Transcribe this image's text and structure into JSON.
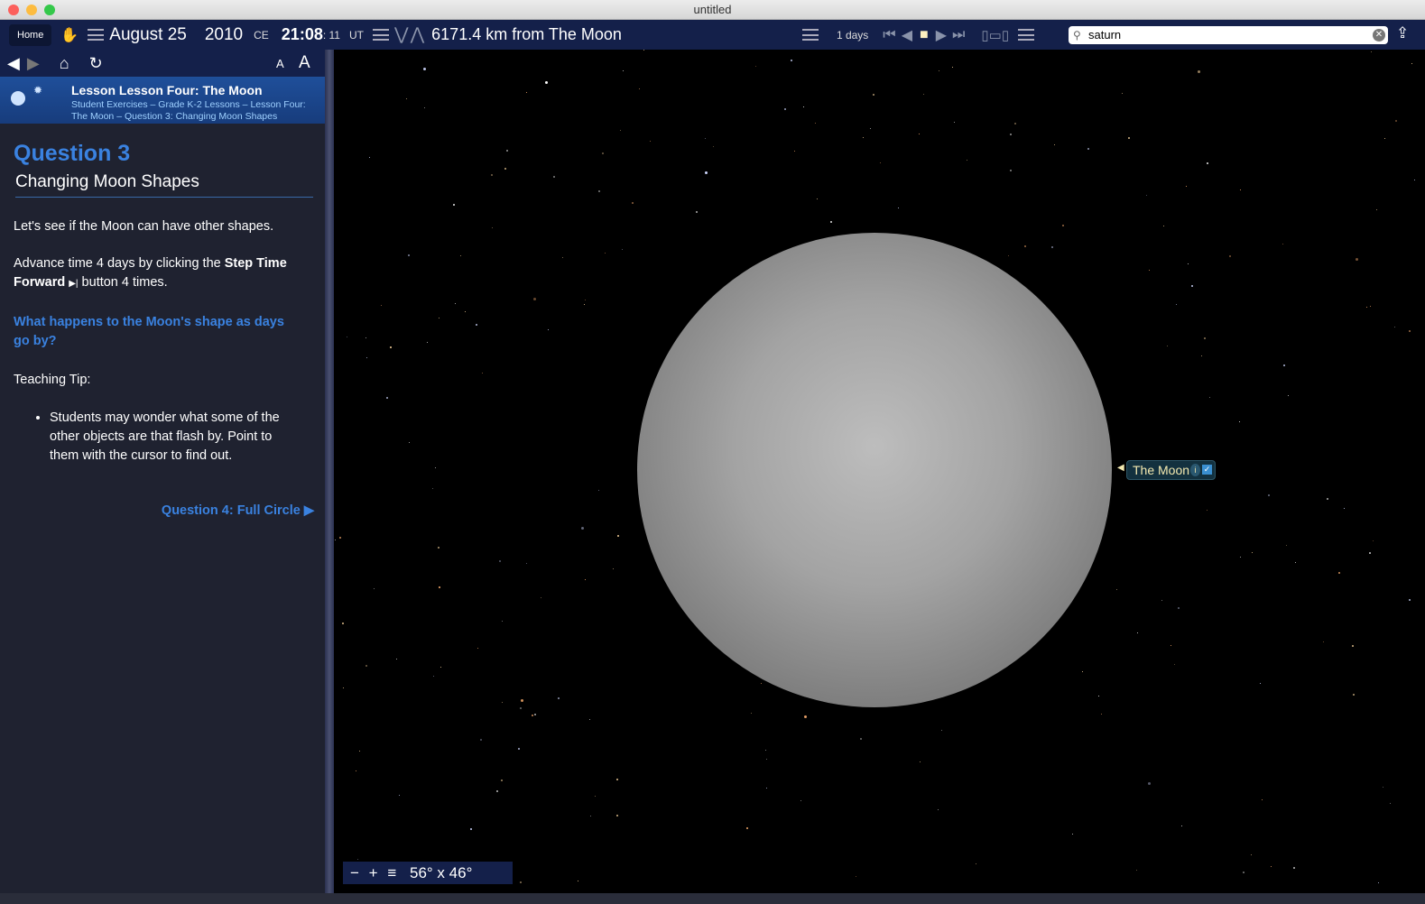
{
  "window": {
    "title": "untitled"
  },
  "toolbar": {
    "home": "Home",
    "month_day": "August 25",
    "year": "2010",
    "era": "CE",
    "time": "21:08",
    "seconds": ": 11",
    "tz": "UT",
    "distance": "6171.4 km from The Moon",
    "step": "1 days"
  },
  "search": {
    "value": "saturn",
    "icon": "search-icon"
  },
  "sidebar": {
    "lesson_title": "Lesson Lesson Four: The Moon",
    "breadcrumb": "Student Exercises – Grade K-2 Lessons – Lesson Four: The Moon – Question 3: Changing Moon Shapes",
    "question": "Question 3",
    "subtitle": "Changing Moon Shapes",
    "p1": "Let's see if the Moon can have other shapes.",
    "p2a": "Advance time 4 days by clicking the ",
    "p2b": "Step Time Forward",
    "p2c": " button 4 times.",
    "ask": "What happens to the Moon's shape as days go by?",
    "tip": "Teaching Tip:",
    "bullet": "Students may wonder what some of the other objects are that flash by. Point to them with the cursor to find out.",
    "next": "Question 4: Full Circle ▶"
  },
  "sky": {
    "object_label": "The Moon",
    "fov": "56° x 46°"
  },
  "colors": {
    "accent": "#3a82e0",
    "toolbar": "#14204a",
    "label_text": "#f3e9b0"
  }
}
